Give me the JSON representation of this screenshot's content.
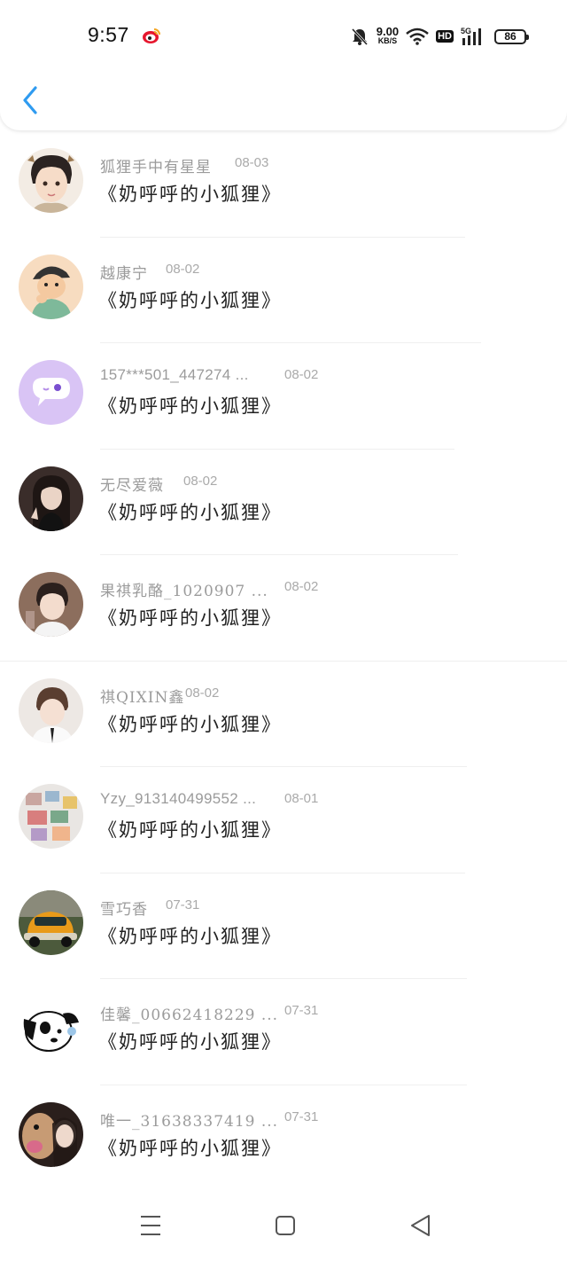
{
  "status_bar": {
    "time": "9:57",
    "net_speed_value": "9.00",
    "net_speed_unit": "KB/S",
    "hd": "HD",
    "network": "5G",
    "battery": "86"
  },
  "colors": {
    "accent": "#2f9bf0",
    "name": "#9b9b9b",
    "title": "#222222"
  },
  "items": [
    {
      "name": "狐狸手中有星星",
      "date": "08-03",
      "title": "《奶呼呼的小狐狸》",
      "avatar": "avatar-boy-cartoon"
    },
    {
      "name": "越康宁",
      "date": "08-02",
      "title": "《奶呼呼的小狐狸》",
      "avatar": "avatar-cartoon-kid"
    },
    {
      "name": "157***501_447274 ...",
      "date": "08-02",
      "title": "《奶呼呼的小狐狸》",
      "avatar": "avatar-chat-bubble"
    },
    {
      "name": "无尽爱薇",
      "date": "08-02",
      "title": "《奶呼呼的小狐狸》",
      "avatar": "avatar-girl-photo"
    },
    {
      "name": "果祺乳酪_1020907 ...",
      "date": "08-02",
      "title": "《奶呼呼的小狐狸》",
      "avatar": "avatar-boy-photo"
    },
    {
      "name": "祺QIXIN鑫",
      "date": "08-02",
      "title": "《奶呼呼的小狐狸》",
      "avatar": "avatar-boy-photo-2"
    },
    {
      "name": "Yzy_913140499552 ...",
      "date": "08-01",
      "title": "《奶呼呼的小狐狸》",
      "avatar": "avatar-collage"
    },
    {
      "name": "雪巧香",
      "date": "07-31",
      "title": "《奶呼呼的小狐狸》",
      "avatar": "avatar-car"
    },
    {
      "name": "佳馨_00662418229 ...",
      "date": "07-31",
      "title": "《奶呼呼的小狐狸》",
      "avatar": "avatar-dog-cartoon"
    },
    {
      "name": "唯一_31638337419 ...",
      "date": "07-31",
      "title": "《奶呼呼的小狐狸》",
      "avatar": "avatar-dog-photo"
    }
  ],
  "nav": {
    "menu_icon": "menu-icon",
    "home_icon": "home-icon",
    "back_icon": "back-triangle-icon"
  }
}
